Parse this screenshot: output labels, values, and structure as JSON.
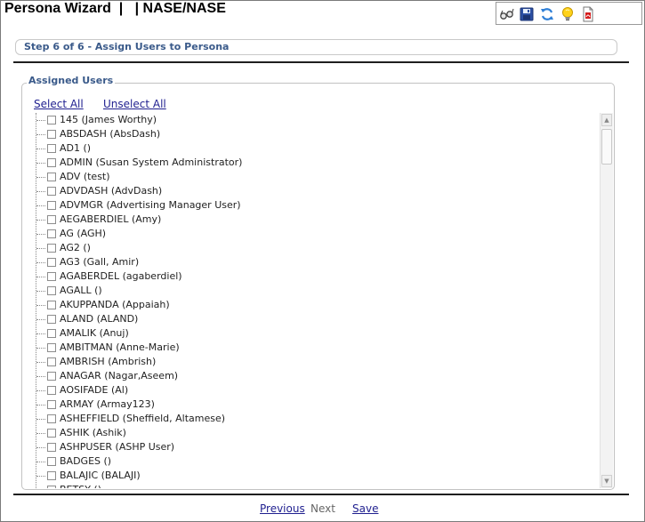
{
  "header": {
    "title": "Persona Wizard  |   | NASE/NASE"
  },
  "toolbar": {
    "buttons": [
      {
        "icon": "glasses-icon",
        "label": "View"
      },
      {
        "icon": "save-icon",
        "label": "Save"
      },
      {
        "icon": "refresh-icon",
        "label": "Refresh"
      },
      {
        "icon": "lightbulb-icon",
        "label": "Tips"
      },
      {
        "icon": "pdf-icon",
        "label": "PDF"
      }
    ]
  },
  "step": {
    "title": "Step 6 of 6 - Assign Users to Persona"
  },
  "assigned": {
    "legend": "Assigned Users",
    "select_all": "Select All",
    "unselect_all": "Unselect All",
    "users": [
      "145 (James Worthy)",
      "ABSDASH (AbsDash)",
      "AD1 ()",
      "ADMIN (Susan System Administrator)",
      "ADV (test)",
      "ADVDASH (AdvDash)",
      "ADVMGR (Advertising Manager User)",
      "AEGABERDIEL (Amy)",
      "AG (AGH)",
      "AG2 ()",
      "AG3 (Gall, Amir)",
      "AGABERDEL (agaberdiel)",
      "AGALL ()",
      "AKUPPANDA (Appaiah)",
      "ALAND (ALAND)",
      "AMALIK (Anuj)",
      "AMBITMAN (Anne-Marie)",
      "AMBRISH (Ambrish)",
      "ANAGAR (Nagar,Aseem)",
      "AOSIFADE (Al)",
      "ARMAY (Armay123)",
      "ASHEFFIELD (Sheffield, Altamese)",
      "ASHIK (Ashik)",
      "ASHPUSER (ASHP User)",
      "BADGES ()",
      "BALAJIC (BALAJI)",
      "BETSY ()"
    ]
  },
  "footer": {
    "previous": "Previous",
    "next": "Next",
    "save": "Save"
  },
  "colors": {
    "accent": "#3a5a8a",
    "link": "#1f1f8f"
  }
}
